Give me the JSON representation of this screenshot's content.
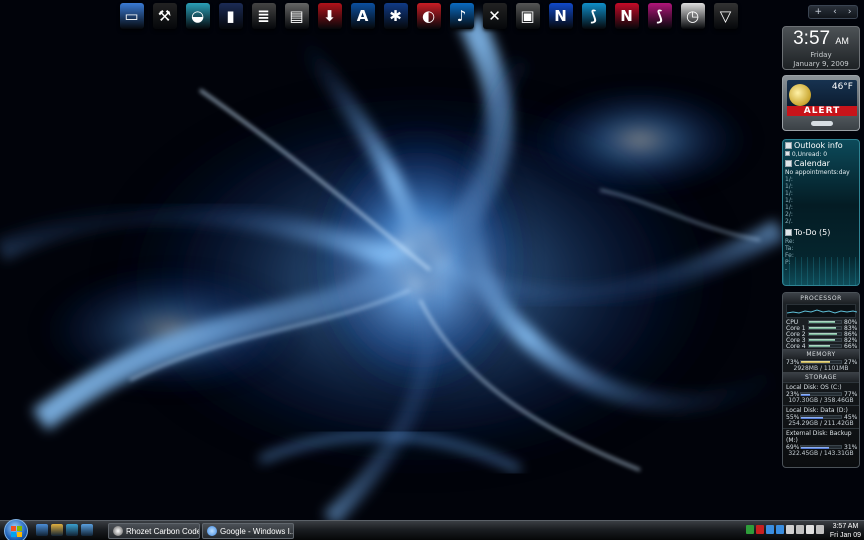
{
  "desktop": {
    "dock_icons": [
      {
        "name": "computer-icon",
        "color": "#3a7bd5",
        "glyph": "▭"
      },
      {
        "name": "tools-icon",
        "color": "#222",
        "glyph": "⚒"
      },
      {
        "name": "wifi-router-icon",
        "color": "#2a9fb7",
        "glyph": "◒"
      },
      {
        "name": "book-icon",
        "color": "#1b2b55",
        "glyph": "▮"
      },
      {
        "name": "stack-icon",
        "color": "#444",
        "glyph": "≣"
      },
      {
        "name": "document-icon",
        "color": "#666",
        "glyph": "▤"
      },
      {
        "name": "download-icon",
        "color": "#b1121a",
        "glyph": "⬇"
      },
      {
        "name": "font-icon",
        "color": "#0b4fa0",
        "glyph": "A"
      },
      {
        "name": "media-icon",
        "color": "#103a86",
        "glyph": "✱"
      },
      {
        "name": "image-icon",
        "color": "#c81d25",
        "glyph": "◐"
      },
      {
        "name": "music-icon",
        "color": "#0a6ac0",
        "glyph": "♪"
      },
      {
        "name": "games-icon",
        "color": "#222",
        "glyph": "✕"
      },
      {
        "name": "software-icon",
        "color": "#555",
        "glyph": "▣"
      },
      {
        "name": "app-blue-icon",
        "color": "#1149c9",
        "glyph": "N"
      },
      {
        "name": "app-cyan-icon",
        "color": "#0f8fc9",
        "glyph": "⟆"
      },
      {
        "name": "app-red-icon",
        "color": "#c50a28",
        "glyph": "N"
      },
      {
        "name": "app-magenta-icon",
        "color": "#b0157a",
        "glyph": "⟆"
      },
      {
        "name": "clock-icon",
        "color": "#dddddd",
        "glyph": "◷"
      },
      {
        "name": "recycle-bin-icon",
        "color": "#333",
        "glyph": "▽"
      }
    ]
  },
  "sidebar": {
    "controls": [
      "+",
      "‹",
      "›"
    ],
    "clock": {
      "time": "3:57",
      "ampm": "AM",
      "day": "Friday",
      "date": "January 9, 2009"
    },
    "weather": {
      "temp": "46°F",
      "alert": "ALERT"
    },
    "outlook": {
      "title": "Outlook info",
      "unread": "0,Unread: 0",
      "calendar_title": "Calendar",
      "calendar_note": "No appointments:day",
      "calendar_lines": [
        "1/:",
        "1/:",
        "1/:",
        "1/:",
        "1/:",
        "2/:",
        "2/."
      ],
      "todo_title": "To-Do (5)",
      "todo_lines": [
        "Re:",
        "Ta:",
        "Fe:",
        "P:",
        "-"
      ]
    },
    "processor": {
      "title": "PROCESSOR",
      "rows": [
        {
          "label": "CPU",
          "value": "80%",
          "fill": 0.8
        },
        {
          "label": "Core 1",
          "value": "83%",
          "fill": 0.83
        },
        {
          "label": "Core 2",
          "value": "86%",
          "fill": 0.86
        },
        {
          "label": "Core 3",
          "value": "82%",
          "fill": 0.82
        },
        {
          "label": "Core 4",
          "value": "66%",
          "fill": 0.66
        }
      ]
    },
    "memory": {
      "title": "MEMORY",
      "used_pct": "73%",
      "free_pct": "27%",
      "detail": "2928MB / 1101MB",
      "fill": 0.73
    },
    "storage": {
      "title": "STORAGE",
      "disks": [
        {
          "name": "Local Disk: OS (C:)",
          "used_pct": "23%",
          "free_pct": "77%",
          "detail": "107.30GB / 358.46GB",
          "fill": 0.23
        },
        {
          "name": "Local Disk: Data (D:)",
          "used_pct": "55%",
          "free_pct": "45%",
          "detail": "254.29GB / 211.42GB",
          "fill": 0.55
        },
        {
          "name": "External Disk: Backup (M:)",
          "used_pct": "69%",
          "free_pct": "31%",
          "detail": "322.45GB / 143.31GB",
          "fill": 0.69
        }
      ]
    }
  },
  "taskbar": {
    "tasks": [
      {
        "label": "Rhozet Carbon Coder",
        "icon_color": "#ffffff"
      },
      {
        "label": "Google - Windows I...",
        "icon_color": "#3b86e0"
      }
    ],
    "quick_launch": [
      "#4d8fd8",
      "#e0b040",
      "#3aa0d0",
      "#5aa0e0"
    ],
    "tray": [
      "#2e9d3a",
      "#c82020",
      "#3a8ee0",
      "#3a8ee0",
      "#d0d0d0",
      "#c0c0c0",
      "#e0e0e0",
      "#c0c0c0"
    ],
    "clock": {
      "time": "3:57 AM",
      "date": "Fri Jan 09"
    }
  }
}
